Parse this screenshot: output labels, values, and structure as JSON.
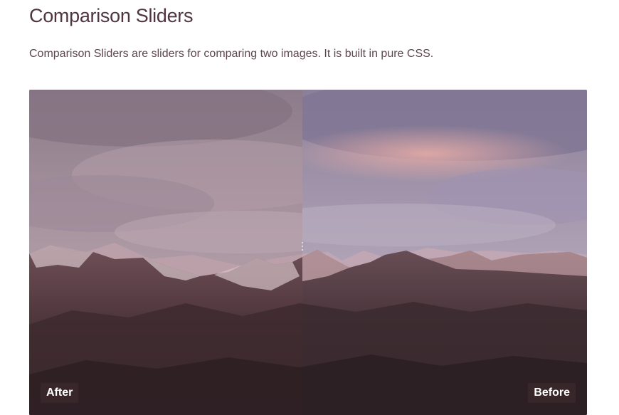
{
  "page": {
    "title": "Comparison Sliders",
    "description": "Comparison Sliders are sliders for comparing two images. It is built in pure CSS."
  },
  "slider": {
    "position_percent": 50,
    "after_label": "After",
    "before_label": "Before",
    "handle_icon": "vertical-dots-grip-icon"
  },
  "colors": {
    "sky_top": "#8e8196",
    "sky_pink": "#cfa3aa",
    "mountain_dark": "#3d2b30",
    "label_bg": "#3c282d"
  }
}
